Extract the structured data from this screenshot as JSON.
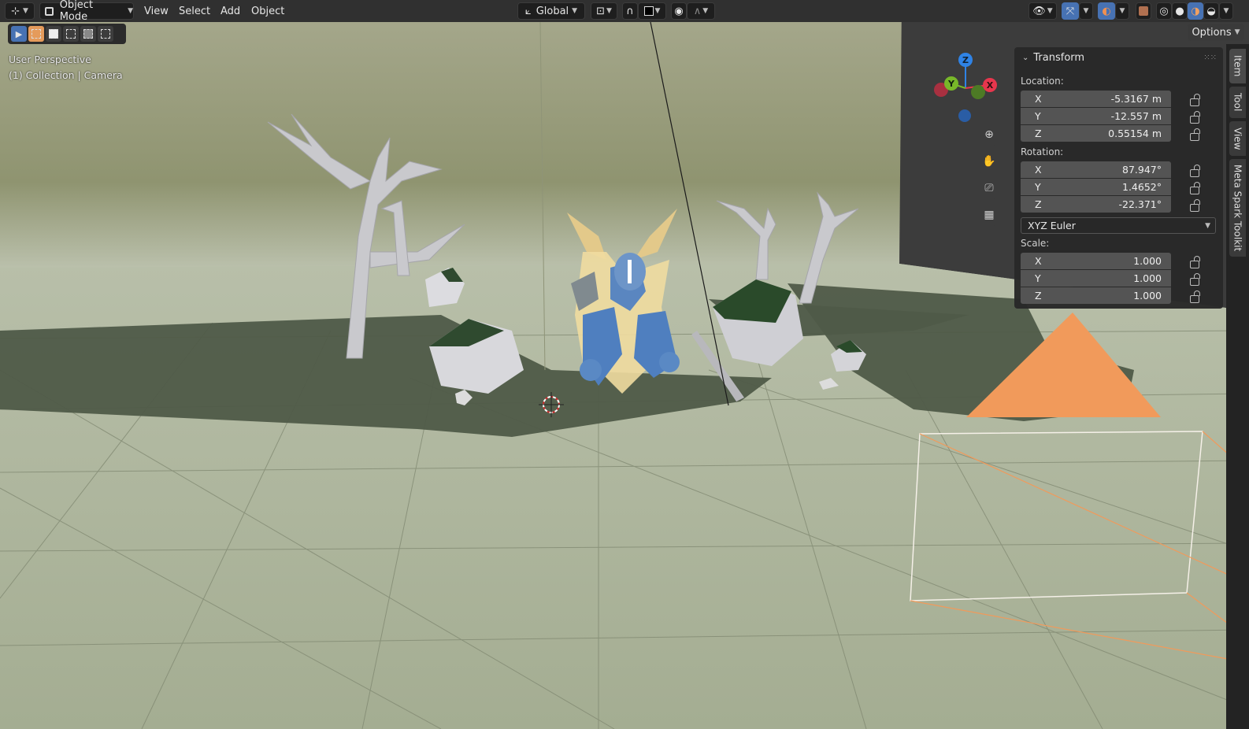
{
  "header": {
    "mode_label": "Object Mode",
    "menus": [
      "View",
      "Select",
      "Add",
      "Object"
    ],
    "transform_orientation": "Global",
    "options_label": "Options"
  },
  "viewport": {
    "perspective_label": "User Perspective",
    "collection_label": "(1) Collection | Camera"
  },
  "gizmo": {
    "x": "X",
    "y": "Y",
    "z": "Z"
  },
  "transform_panel": {
    "title": "Transform",
    "location_label": "Location:",
    "location": [
      {
        "axis": "X",
        "value": "-5.3167 m"
      },
      {
        "axis": "Y",
        "value": "-12.557 m"
      },
      {
        "axis": "Z",
        "value": "0.55154 m"
      }
    ],
    "rotation_label": "Rotation:",
    "rotation": [
      {
        "axis": "X",
        "value": "87.947°"
      },
      {
        "axis": "Y",
        "value": "1.4652°"
      },
      {
        "axis": "Z",
        "value": "-22.371°"
      }
    ],
    "rotation_mode": "XYZ Euler",
    "scale_label": "Scale:",
    "scale": [
      {
        "axis": "X",
        "value": "1.000"
      },
      {
        "axis": "Y",
        "value": "1.000"
      },
      {
        "axis": "Z",
        "value": "1.000"
      }
    ]
  },
  "side_tabs": [
    "Item",
    "Tool",
    "View",
    "Meta Spark Toolkit"
  ],
  "colors": {
    "header_bg": "#303030",
    "panel_bg": "#282828",
    "field_bg": "#545454",
    "accent_blue": "#4772b3",
    "camera_orange": "#f0a060",
    "axis_x": "#e8364d",
    "axis_y": "#78b829",
    "axis_z": "#2f83e6"
  }
}
